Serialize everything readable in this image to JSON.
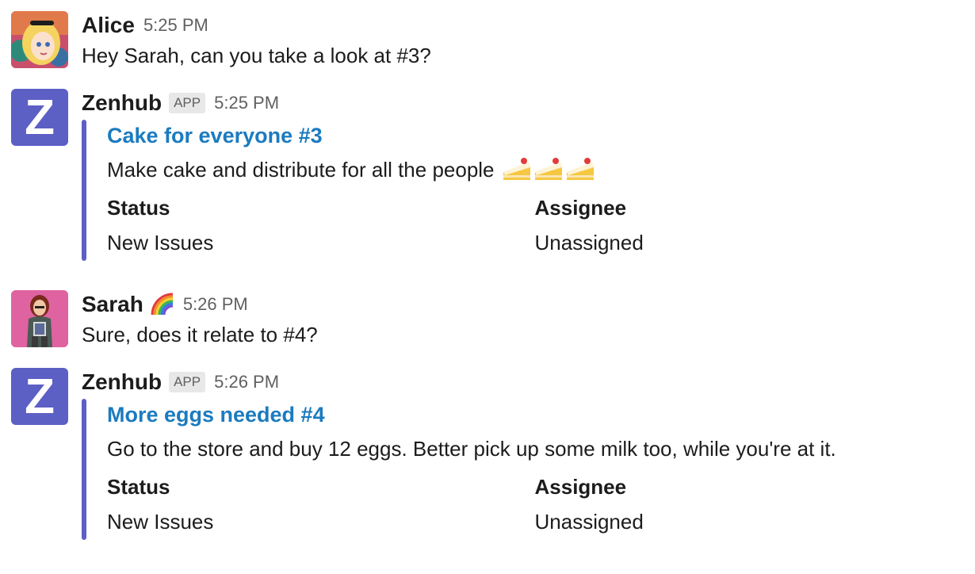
{
  "messages": [
    {
      "author": "Alice",
      "time": "5:25 PM",
      "text": "Hey Sarah, can you take a look at #3?"
    },
    {
      "author": "Zenhub",
      "badge": "APP",
      "time": "5:25 PM",
      "avatar_letter": "Z",
      "issue": {
        "title": "Cake for everyone #3",
        "description": "Make cake and distribute for all the people",
        "emoji": [
          "cake-icon",
          "cake-icon",
          "cake-icon"
        ],
        "fields": [
          {
            "title": "Status",
            "value": "New Issues"
          },
          {
            "title": "Assignee",
            "value": "Unassigned"
          }
        ]
      }
    },
    {
      "author": "Sarah",
      "status_emoji": "rainbow-icon",
      "time": "5:26 PM",
      "text": "Sure, does it relate to #4?"
    },
    {
      "author": "Zenhub",
      "badge": "APP",
      "time": "5:26 PM",
      "avatar_letter": "Z",
      "issue": {
        "title": "More eggs needed #4",
        "description": "Go to the store and buy 12 eggs. Better pick up some milk too, while you're at it.",
        "fields": [
          {
            "title": "Status",
            "value": "New Issues"
          },
          {
            "title": "Assignee",
            "value": "Unassigned"
          }
        ]
      }
    }
  ],
  "colors": {
    "zenhub_purple": "#5c5fc4",
    "link_blue": "#1b7bbf",
    "muted": "#616061"
  }
}
